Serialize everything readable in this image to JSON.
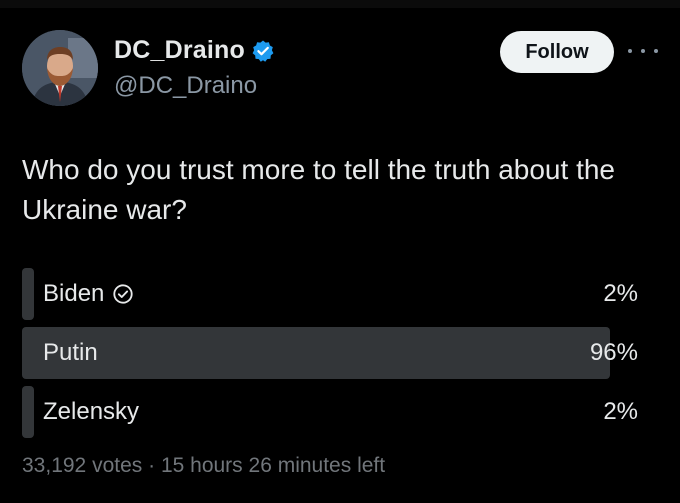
{
  "author": {
    "display_name": "DC_Draino",
    "handle": "@DC_Draino",
    "verified": true,
    "avatar_icon": "profile-photo"
  },
  "actions": {
    "follow_label": "Follow",
    "more_icon": "ellipsis-icon"
  },
  "post": {
    "question": "Who do you trust more to tell the truth about the Ukraine war?"
  },
  "poll": {
    "options": [
      {
        "label": "Biden",
        "percent_text": "2%",
        "value": 2,
        "selected": true
      },
      {
        "label": "Putin",
        "percent_text": "96%",
        "value": 96,
        "selected": false
      },
      {
        "label": "Zelensky",
        "percent_text": "2%",
        "value": 2,
        "selected": false
      }
    ],
    "votes_text": "33,192 votes",
    "separator": "·",
    "time_left": "15 hours 26 minutes left"
  },
  "colors": {
    "background": "#000000",
    "text": "#e7e9ea",
    "secondary": "#8b98a5",
    "bar": "#333639",
    "verified_blue": "#1d9bf0",
    "follow_bg": "#eff3f4"
  }
}
